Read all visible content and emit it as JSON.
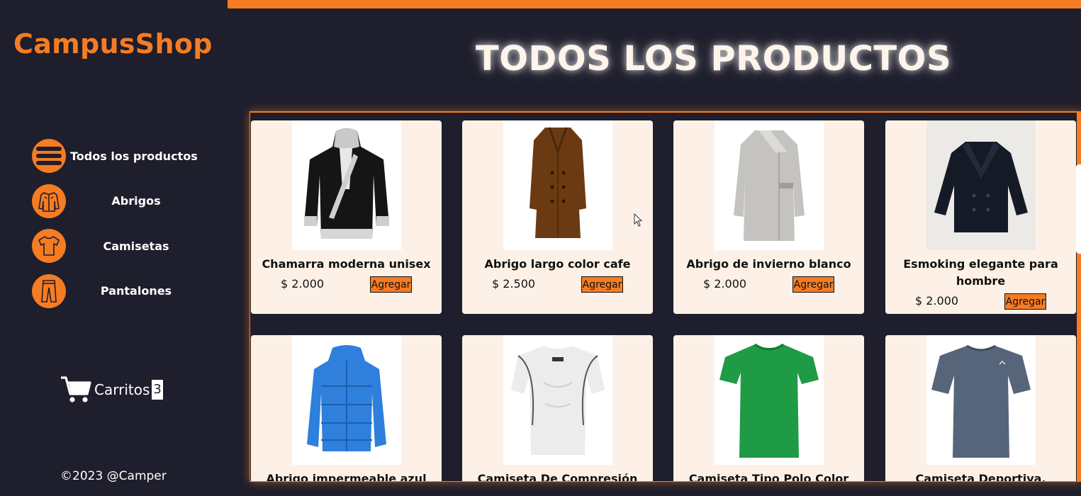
{
  "app": {
    "logo": "CampusShop",
    "accent": "#f57c22"
  },
  "sidebar": {
    "items": [
      {
        "label": "Todos los productos",
        "icon": "list-icon",
        "active": true
      },
      {
        "label": "Abrigos",
        "icon": "jacket-icon",
        "active": false
      },
      {
        "label": "Camisetas",
        "icon": "tshirt-icon",
        "active": false
      },
      {
        "label": "Pantalones",
        "icon": "pants-icon",
        "active": false
      }
    ],
    "cart": {
      "label": "Carritos",
      "count": "3",
      "icon": "cart-icon"
    },
    "footer": "©2023 @Camper"
  },
  "main": {
    "title": "TODOS LOS PRODUCTOS",
    "products": [
      {
        "name": "Chamarra moderna unisex",
        "price": "$ 2.000",
        "button": "Agregar",
        "image": "black-white-jacket"
      },
      {
        "name": "Abrigo largo color cafe",
        "price": "$ 2.500",
        "button": "Agregar",
        "image": "brown-coat"
      },
      {
        "name": "Abrigo de invierno blanco",
        "price": "$ 2.000",
        "button": "Agregar",
        "image": "grey-coat"
      },
      {
        "name": "Esmoking elegante para hombre",
        "price": "$ 2.000",
        "button": "Agregar",
        "image": "navy-peacoat"
      },
      {
        "name": "Abrigo impermeable azul cielo",
        "image": "blue-puffer"
      },
      {
        "name": "Camiseta De Compresión En",
        "image": "white-compression-shirt"
      },
      {
        "name": "Camiseta Tipo Polo Color Dama",
        "image": "green-tshirt"
      },
      {
        "name": "Camiseta Deportiva, Crossfit,",
        "image": "grey-sport-tshirt"
      }
    ]
  }
}
